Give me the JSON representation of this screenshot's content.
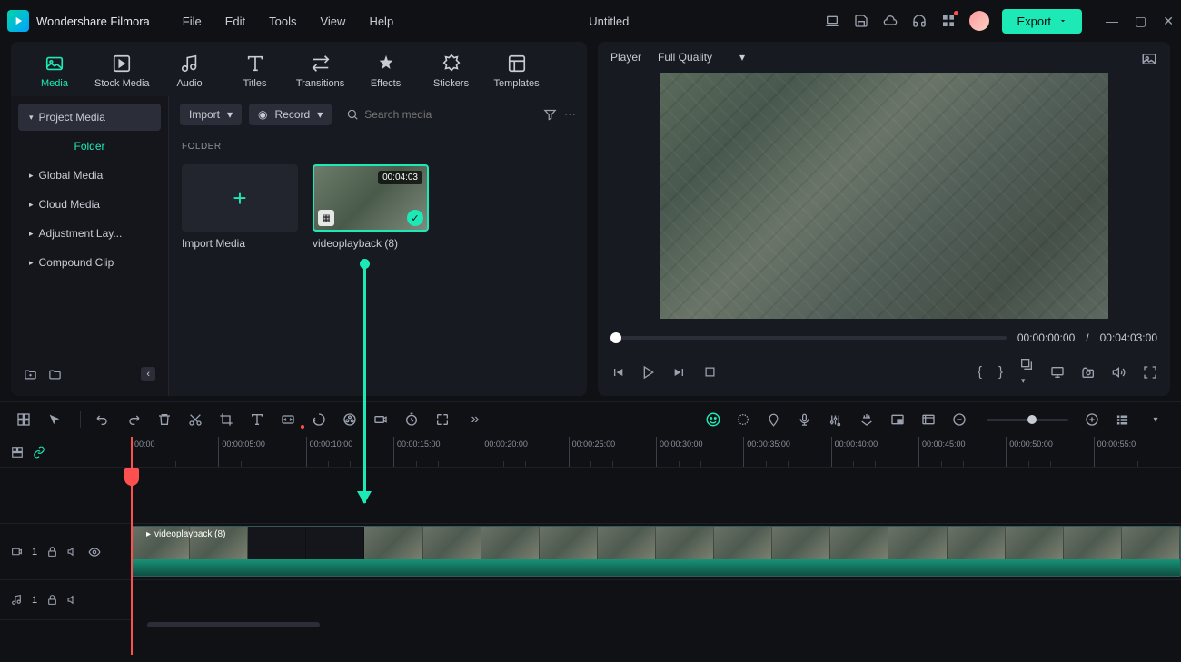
{
  "app": {
    "name": "Wondershare Filmora",
    "title": "Untitled"
  },
  "menu": [
    "File",
    "Edit",
    "Tools",
    "View",
    "Help"
  ],
  "export_label": "Export",
  "ribbon": [
    {
      "label": "Media",
      "active": true
    },
    {
      "label": "Stock Media"
    },
    {
      "label": "Audio"
    },
    {
      "label": "Titles"
    },
    {
      "label": "Transitions"
    },
    {
      "label": "Effects"
    },
    {
      "label": "Stickers"
    },
    {
      "label": "Templates"
    }
  ],
  "sidebar": {
    "project": "Project Media",
    "folder": "Folder",
    "items": [
      "Global Media",
      "Cloud Media",
      "Adjustment Lay...",
      "Compound Clip"
    ]
  },
  "content": {
    "import": "Import",
    "record": "Record",
    "search_ph": "Search media",
    "folder_label": "FOLDER",
    "import_media": "Import Media",
    "clip": {
      "name": "videoplayback (8)",
      "duration": "00:04:03"
    }
  },
  "player": {
    "tab": "Player",
    "quality": "Full Quality",
    "cur": "00:00:00:00",
    "sep": "/",
    "dur": "00:04:03:00"
  },
  "timeline": {
    "ticks": [
      "00:00",
      "00:00:05:00",
      "00:00:10:00",
      "00:00:15:00",
      "00:00:20:00",
      "00:00:25:00",
      "00:00:30:00",
      "00:00:35:00",
      "00:00:40:00",
      "00:00:45:00",
      "00:00:50:00",
      "00:00:55:0"
    ],
    "clip_name": "videoplayback (8)",
    "video_idx": "1",
    "audio_idx": "1"
  }
}
